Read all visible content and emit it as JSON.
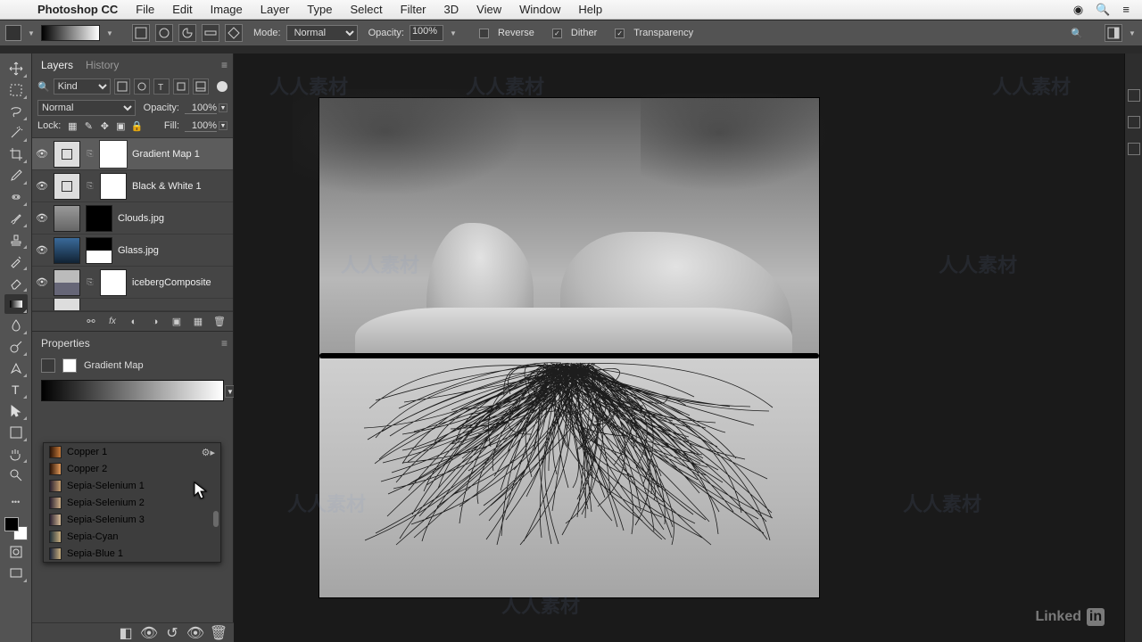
{
  "menubar": {
    "app": "Photoshop CC",
    "items": [
      "File",
      "Edit",
      "Image",
      "Layer",
      "Type",
      "Select",
      "Filter",
      "3D",
      "View",
      "Window",
      "Help"
    ]
  },
  "optionsbar": {
    "mode_label": "Mode:",
    "mode_value": "Normal",
    "opacity_label": "Opacity:",
    "opacity_value": "100%",
    "reverse": "Reverse",
    "dither": "Dither",
    "transparency": "Transparency"
  },
  "layers_panel": {
    "tabs": {
      "layers": "Layers",
      "history": "History"
    },
    "filter_label": "Kind",
    "blend_mode": "Normal",
    "opacity_label": "Opacity:",
    "opacity_value": "100%",
    "lock_label": "Lock:",
    "fill_label": "Fill:",
    "fill_value": "100%",
    "layers": [
      {
        "name": "Gradient Map 1",
        "selected": true,
        "adj": true,
        "mask": "white"
      },
      {
        "name": "Black & White 1",
        "selected": false,
        "adj": true,
        "mask": "white"
      },
      {
        "name": "Clouds.jpg",
        "selected": false,
        "adj": false,
        "mask": "black"
      },
      {
        "name": "Glass.jpg",
        "selected": false,
        "adj": false,
        "mask": "halves"
      },
      {
        "name": "icebergComposite",
        "selected": false,
        "adj": false,
        "mask": "white"
      }
    ]
  },
  "properties_panel": {
    "title": "Properties",
    "adjustment": "Gradient Map"
  },
  "gradient_presets": {
    "items": [
      {
        "name": "Copper 1",
        "from": "#2a1205",
        "to": "#c67a3a"
      },
      {
        "name": "Copper 2",
        "from": "#2a1205",
        "to": "#e29a5a"
      },
      {
        "name": "Sepia-Selenium 1",
        "from": "#2a2030",
        "to": "#c9a070"
      },
      {
        "name": "Sepia-Selenium 2",
        "from": "#2a2030",
        "to": "#d0b088"
      },
      {
        "name": "Sepia-Selenium 3",
        "from": "#2a2030",
        "to": "#d8bc98"
      },
      {
        "name": "Sepia-Cyan",
        "from": "#203038",
        "to": "#c9b080"
      },
      {
        "name": "Sepia-Blue 1",
        "from": "#1a2238",
        "to": "#c9b080"
      }
    ]
  },
  "branding": {
    "linkedin": "Linked"
  }
}
